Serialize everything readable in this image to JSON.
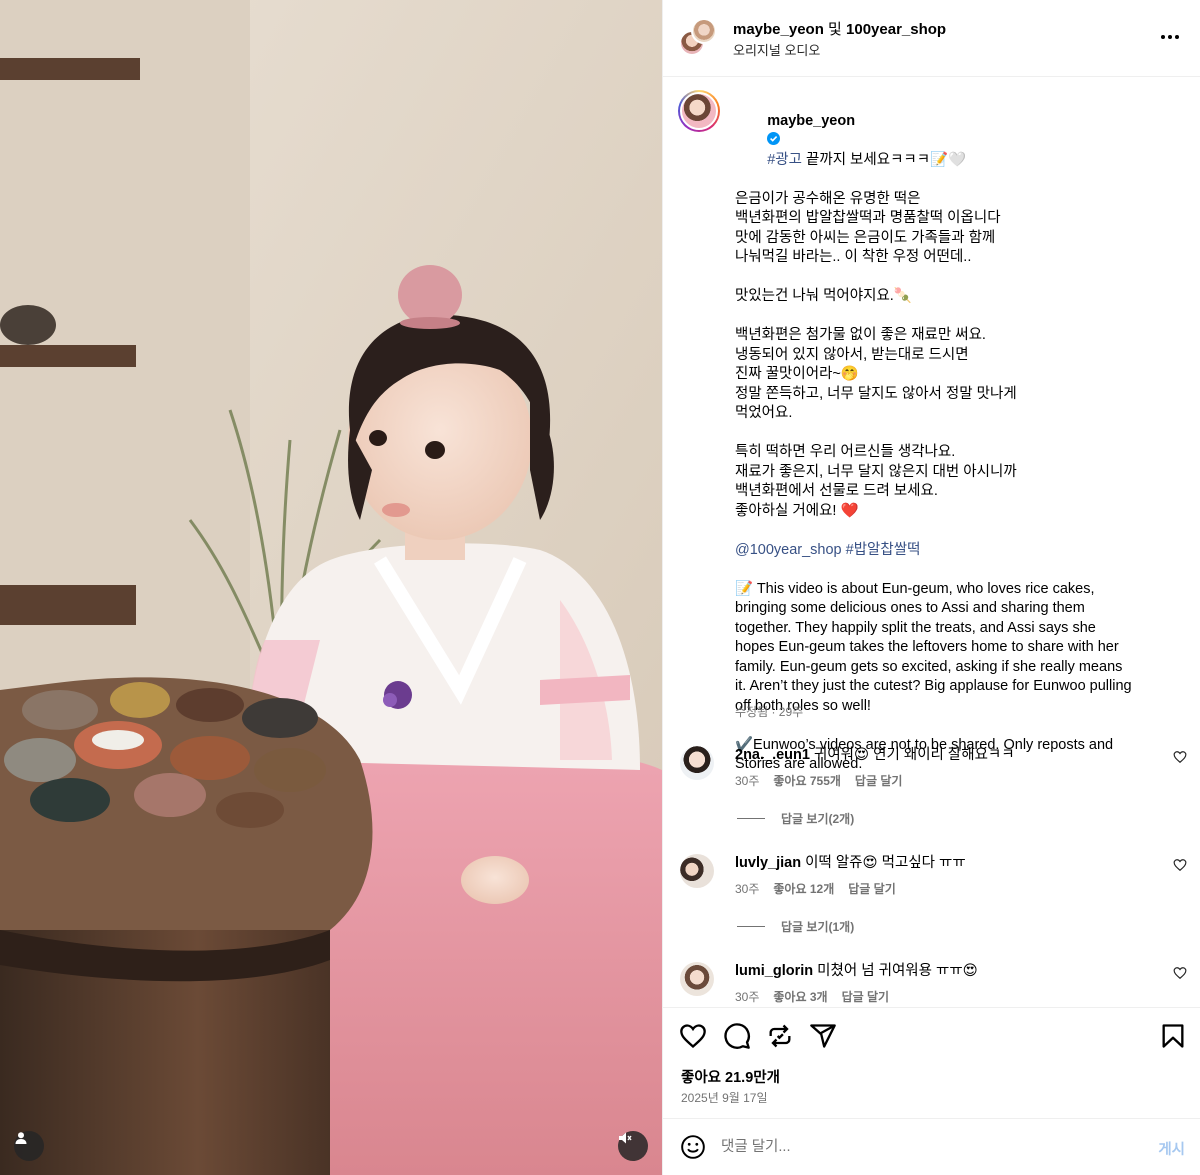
{
  "header": {
    "user1": "maybe_yeon",
    "joiner": " 및 ",
    "user2": "100year_shop",
    "audio": "오리지널 오디오"
  },
  "caption": {
    "username": "maybe_yeon",
    "hashtag_ad": "#광고",
    "line1_rest": " 끝까지 보세요ㅋㅋㅋ📝🤍",
    "lines_a": [
      "은금이가 공수해온 유명한 떡은",
      "백년화편의 밥알찹쌀떡과 명품찰떡 이옵니다",
      "맛에 감동한 아씨는 은금이도 가족들과 함께",
      "나눠먹길 바라는.. 이 착한 우정 어떤데.."
    ],
    "line_b": "맛있는건 나눠 먹어야지요.🍡",
    "lines_c": [
      "백년화편은 첨가물 없이 좋은 재료만 써요.",
      "냉동되어 있지 않아서, 받는대로 드시면",
      "진짜 꿀맛이어라~🤭",
      "정말 쫀득하고, 너무 달지도 않아서 정말 맛나게",
      "먹었어요."
    ],
    "lines_d": [
      "특히 떡하면 우리 어르신들 생각나요.",
      "재료가 좋은지, 너무 달지 않은지 대번 아시니까",
      "백년화편에서 선물로 드려 보세요.",
      "좋아하실 거에요! ❤️"
    ],
    "tags": "@100year_shop #밥알찹쌀떡",
    "en_lines": [
      "📝 This video is about Eun-geum, who loves rice cakes,",
      "bringing some delicious ones to Assi and sharing them",
      "together. They happily split the treats, and Assi says she",
      "hopes Eun-geum takes the leftovers home to share with her",
      "family. Eun-geum gets so excited, asking if she really means",
      "it. Aren’t they just the cutest? Big applause for Eunwoo pulling",
      "off both roles so well!"
    ],
    "note_lines": [
      "✔️Eunwoo’s videos are not to be shared. Only reposts and",
      "Stories are allowed."
    ],
    "meta": "수정됨 · 29주"
  },
  "comments": [
    {
      "username": "2na._.eun1",
      "text": " 귀여워😍 연기 왜이리 잘해요ㅋㅋ",
      "age": "30주",
      "likes": "좋아요 755개",
      "reply": "답글 달기",
      "view_replies": "답글 보기(2개)"
    },
    {
      "username": "luvly_jian",
      "text": " 이떡 알쥬😍 먹고싶다 ㅠㅠ",
      "age": "30주",
      "likes": "좋아요 12개",
      "reply": "답글 달기",
      "view_replies": "답글 보기(1개)"
    },
    {
      "username": "lumi_glorin",
      "text": " 미쳤어 넘 귀여워용 ㅠㅠ😍",
      "age": "30주",
      "likes": "좋아요 3개",
      "reply": "답글 달기"
    }
  ],
  "actions": {
    "likes": "좋아요 21.9만개",
    "date": "2025년 9월 17일"
  },
  "comment_box": {
    "placeholder": "댓글 달기...",
    "post": "게시"
  },
  "colors": {
    "link": "#385185",
    "muted": "#737373",
    "post_button": "#a6c8f0"
  },
  "icons": [
    "more-options-icon",
    "verified-badge-icon",
    "heart-icon",
    "comment-icon",
    "repost-icon",
    "share-icon",
    "bookmark-icon",
    "emoji-icon",
    "user-tag-icon",
    "sound-off-icon"
  ]
}
